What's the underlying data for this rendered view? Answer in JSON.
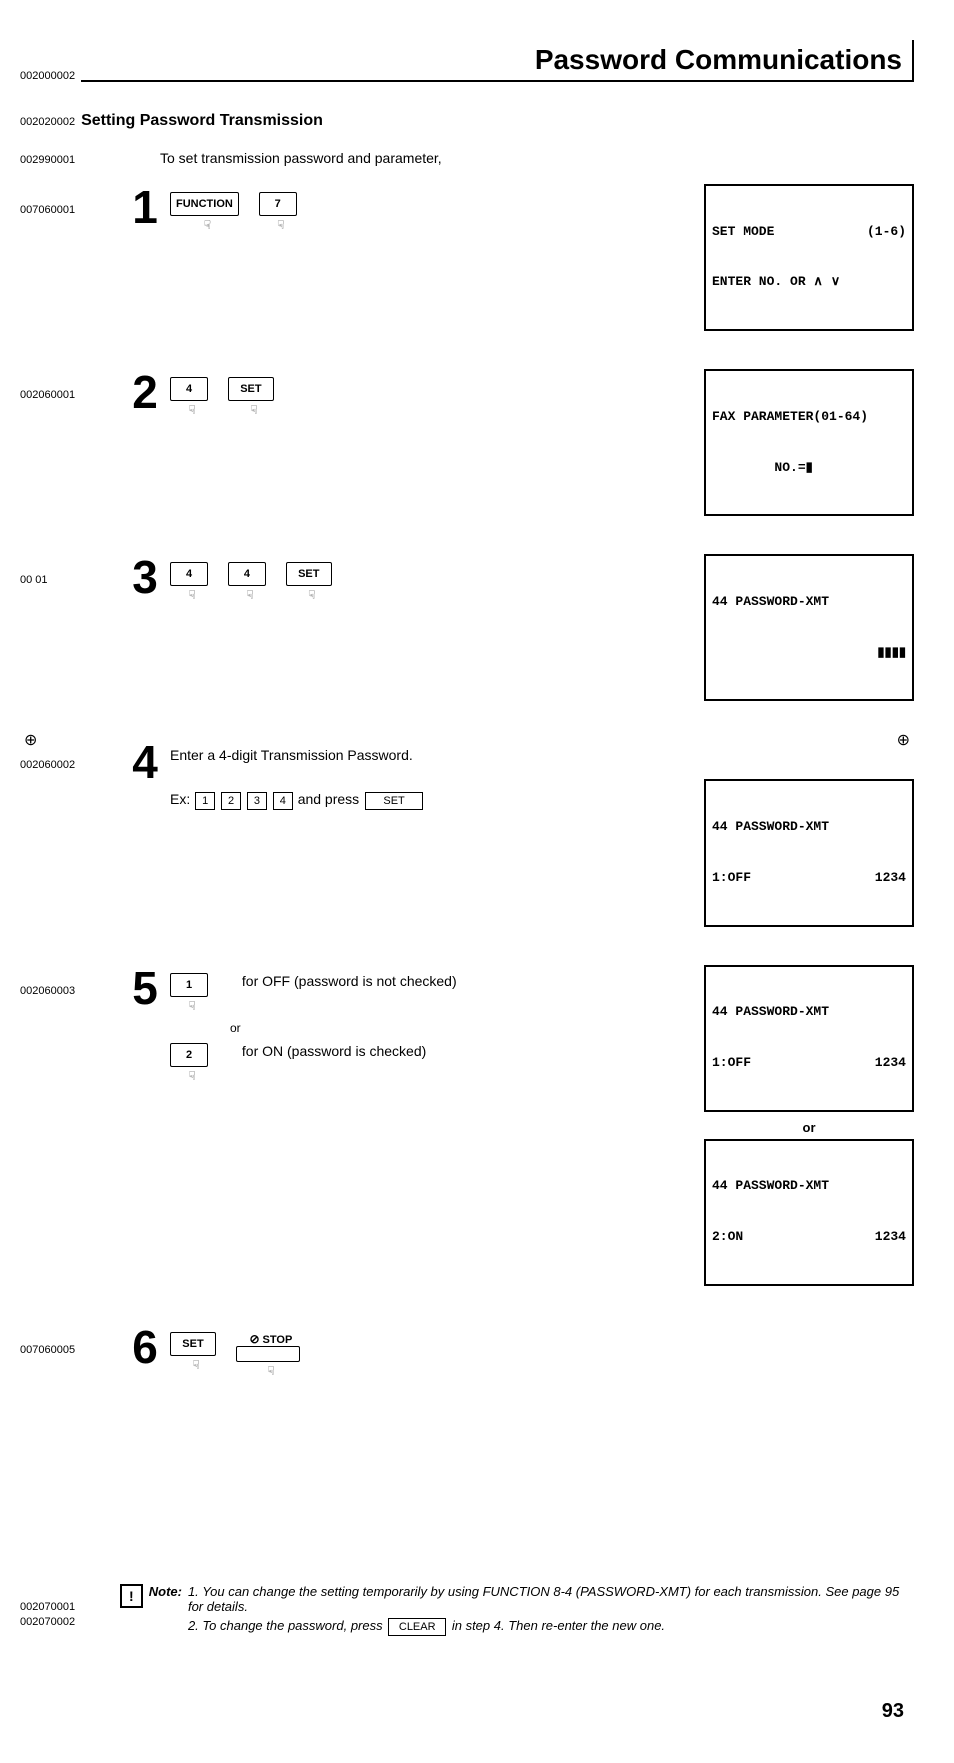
{
  "header": {
    "code": "002000002",
    "title": "Password Communications"
  },
  "section": {
    "code": "002020002",
    "title": "Setting Password Transmission"
  },
  "intro": {
    "code": "002990001",
    "text": "To set transmission password and parameter,"
  },
  "steps": {
    "s1": {
      "code": "007060001",
      "num": "1",
      "keys": {
        "k1": "FUNCTION",
        "k2": "7"
      },
      "lcd": {
        "l1a": "SET MODE",
        "l1b": "(1-6)",
        "l2": "ENTER NO. OR ∧ ∨"
      }
    },
    "s2": {
      "code": "002060001",
      "num": "2",
      "keys": {
        "k1": "4",
        "k2": "SET"
      },
      "lcd": {
        "l1": "FAX PARAMETER(01-64)",
        "l2": "        NO.=▮"
      }
    },
    "s3": {
      "code": "00     01",
      "num": "3",
      "keys": {
        "k1": "4",
        "k2": "4",
        "k3": "SET"
      },
      "lcd": {
        "l1": "44 PASSWORD-XMT",
        "l2": "            ▮▮▮▮"
      }
    },
    "s4": {
      "code": "002060002",
      "num": "4",
      "text1": "Enter a 4-digit Transmission Password.",
      "ex_label": "Ex:",
      "ex_keys": {
        "k1": "1",
        "k2": "2",
        "k3": "3",
        "k4": "4"
      },
      "ex_mid": " and press ",
      "ex_set": "SET",
      "lcd": {
        "l1": "44 PASSWORD-XMT",
        "l2a": "1:OFF",
        "l2b": "1234"
      }
    },
    "s5": {
      "code": "002060003",
      "num": "5",
      "opt_off": {
        "key": "1",
        "text": "for OFF (password is not checked)"
      },
      "or": "or",
      "opt_on": {
        "key": "2",
        "text": "for ON (password is checked)"
      },
      "lcd_off": {
        "l1": "44 PASSWORD-XMT",
        "l2a": "1:OFF",
        "l2b": "1234"
      },
      "lcd_or": "or",
      "lcd_on": {
        "l1": "44 PASSWORD-XMT",
        "l2a": "2:ON",
        "l2b": "1234"
      }
    },
    "s6": {
      "code": "007060005",
      "num": "6",
      "keys": {
        "k1": "SET",
        "k2_label": "STOP"
      }
    }
  },
  "notes": {
    "icon": "!",
    "label": "Note:",
    "codes": {
      "c1": "002070001",
      "c2": "002070002"
    },
    "n1_num": "1.",
    "n1": "You can change the setting temporarily by using FUNCTION 8-4 (PASSWORD-XMT) for each transmission.  See page 95 for details.",
    "n2_num": "2.",
    "n2_a": "To change the password, press ",
    "n2_key": "CLEAR",
    "n2_b": " in step 4. Then re-enter the new one."
  },
  "page_number": "93"
}
